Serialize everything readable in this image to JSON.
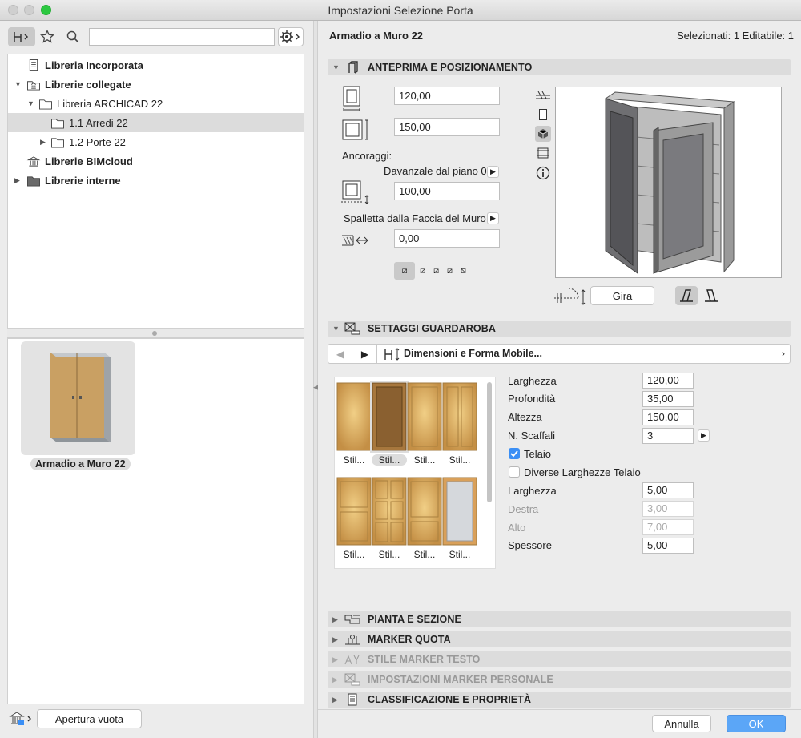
{
  "window": {
    "title": "Impostazioni Selezione Porta"
  },
  "left": {
    "tree": [
      {
        "label": "Libreria Incorporata",
        "bold": true
      },
      {
        "label": "Librerie collegate",
        "bold": true
      },
      {
        "label": "Libreria ARCHICAD 22",
        "bold": false
      },
      {
        "label": "1.1 Arredi 22",
        "bold": false
      },
      {
        "label": "1.2 Porte 22",
        "bold": false
      },
      {
        "label": "Librerie BIMcloud",
        "bold": true
      },
      {
        "label": "Librerie interne",
        "bold": true
      }
    ],
    "preview_caption": "Armadio a Muro 22",
    "open_empty_button": "Apertura vuota"
  },
  "right": {
    "object_name": "Armadio a Muro 22",
    "selection_info": "Selezionati: 1 Editabile: 1",
    "sections": {
      "preview": "ANTEPRIMA E POSIZIONAMENTO",
      "wardrobe": "SETTAGGI GUARDAROBA",
      "plan": "PIANTA E SEZIONE",
      "dimension": "MARKER QUOTA",
      "text_marker": "STILE MARKER TESTO",
      "custom_marker": "IMPOSTAZIONI MARKER PERSONALE",
      "classification": "CLASSIFICAZIONE E PROPRIETÀ"
    },
    "placement": {
      "width": "120,00",
      "height": "150,00",
      "anchors_label": "Ancoraggi:",
      "sill_label": "Davanzale dal piano 0",
      "sill_value": "100,00",
      "reveal_label": "Spalletta dalla Faccia del Muro",
      "reveal_value": "0,00",
      "flip_button": "Gira"
    },
    "wardrobe": {
      "page_label": "Dimensioni e Forma Mobile...",
      "styles": [
        "Stil...",
        "Stil...",
        "Stil...",
        "Stil...",
        "Stil...",
        "Stil...",
        "Stil...",
        "Stil..."
      ],
      "fields": {
        "larghezza_label": "Larghezza",
        "larghezza": "120,00",
        "profondita_label": "Profondità",
        "profondita": "35,00",
        "altezza_label": "Altezza",
        "altezza": "150,00",
        "scaffali_label": "N. Scaffali",
        "scaffali": "3",
        "telaio_label": "Telaio",
        "diverse_label": "Diverse Larghezze Telaio",
        "frame_larghezza_label": "Larghezza",
        "frame_larghezza": "5,00",
        "destra_label": "Destra",
        "destra": "3,00",
        "alto_label": "Alto",
        "alto": "7,00",
        "spessore_label": "Spessore",
        "spessore": "5,00"
      }
    },
    "buttons": {
      "cancel": "Annulla",
      "ok": "OK"
    }
  },
  "colors": {
    "accent": "#3b8ff5",
    "ok_button": "#5ba6f7",
    "wood": "#c9a063"
  }
}
